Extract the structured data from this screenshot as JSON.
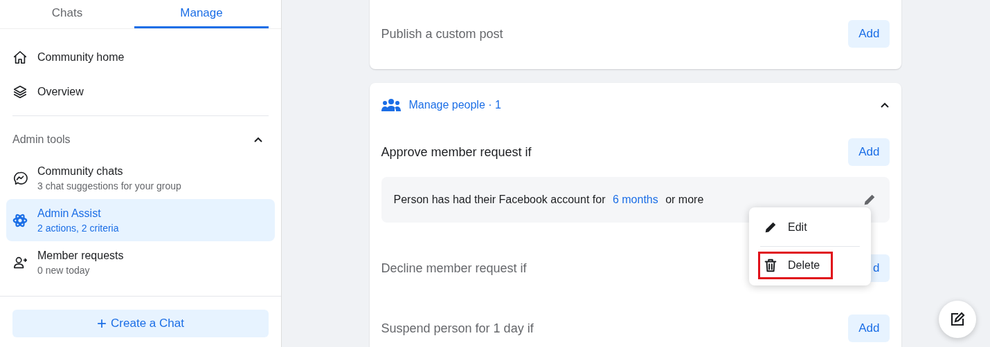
{
  "sidebar": {
    "tabs": [
      {
        "label": "Chats",
        "selected": false
      },
      {
        "label": "Manage",
        "selected": true
      }
    ],
    "nav": [
      {
        "kind": "home",
        "label": "Community home"
      },
      {
        "kind": "layers",
        "label": "Overview"
      }
    ],
    "section": {
      "title": "Admin tools",
      "expanded": true
    },
    "tools": [
      {
        "kind": "chat",
        "title": "Community chats",
        "subtitle": "3 chat suggestions for your group",
        "selected": false
      },
      {
        "kind": "assist",
        "title": "Admin Assist",
        "subtitle": "2 actions, 2 criteria",
        "selected": true
      },
      {
        "kind": "person",
        "title": "Member requests",
        "subtitle": "0 new today",
        "selected": false
      }
    ],
    "create_button": {
      "icon": "+",
      "label": "Create a Chat"
    }
  },
  "main": {
    "top_card": {
      "rows": [
        {
          "label": "Publish a custom post",
          "button": "Add"
        }
      ]
    },
    "people_card": {
      "title": "Manage people · 1",
      "expanded": true,
      "rows": [
        {
          "label": "Approve member request if",
          "active": true,
          "button": "Add",
          "conditions": [
            {
              "before": "Person has had their Facebook account for",
              "value": "6 months",
              "after": "or more"
            }
          ]
        },
        {
          "label": "Decline member request if",
          "active": false,
          "button": "d"
        },
        {
          "label": "Suspend person for 1 day if",
          "active": false,
          "button": "Add"
        }
      ]
    },
    "menu": [
      {
        "kind": "edit",
        "label": "Edit",
        "highlighted": false
      },
      {
        "kind": "delete",
        "label": "Delete",
        "highlighted": true
      }
    ]
  }
}
